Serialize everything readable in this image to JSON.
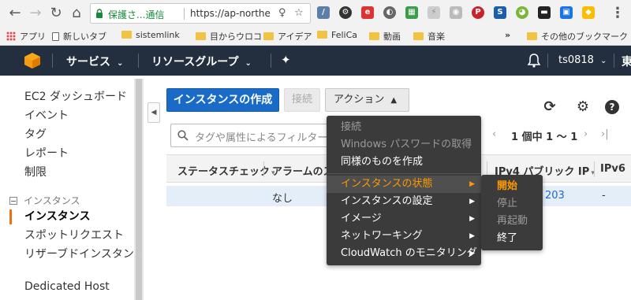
{
  "browser": {
    "secure_label": "保護さ...通信",
    "url": "https://ap-northe",
    "bookmarks": [
      "アプリ",
      "新しいタブ",
      "sistemlink",
      "目からウロコ",
      "アイデア",
      "FeliCa",
      "動画",
      "音楽",
      "その他のブックマーク"
    ],
    "overflow": "»"
  },
  "aws_nav": {
    "services": "サービス",
    "resource_groups": "リソースグループ",
    "user": "ts0818",
    "region_partial": "東"
  },
  "sidebar": {
    "items": [
      "EC2 ダッシュボード",
      "イベント",
      "タグ",
      "レポート",
      "制限"
    ],
    "section": "インスタンス",
    "section_items": [
      "インスタンス",
      "スポットリクエスト",
      "リザーブドインスタンス",
      "Dedicated Host"
    ],
    "active_item": "インスタンス"
  },
  "toolbar": {
    "create_label": "インスタンスの作成",
    "connect_label": "接続",
    "action_label": "アクション"
  },
  "filter": {
    "placeholder": "タグや属性によるフィルター"
  },
  "pagination": {
    "text": "1 個中 1 ～ 1"
  },
  "table": {
    "headers": [
      "ステータスチェック",
      "アラームのス",
      "IPv4 パブリック IP",
      "IPv6"
    ],
    "row": {
      "alarm": "なし",
      "ip_partial": "203",
      "ipv6": "-"
    }
  },
  "action_menu": {
    "items": [
      {
        "label": "接続",
        "enabled": false,
        "has_submenu": false
      },
      {
        "label": "Windows パスワードの取得",
        "enabled": false,
        "has_submenu": false
      },
      {
        "label": "同様のものを作成",
        "enabled": true,
        "has_submenu": false
      },
      {
        "label": "インスタンスの状態",
        "enabled": true,
        "has_submenu": true,
        "highlighted": true
      },
      {
        "label": "インスタンスの設定",
        "enabled": true,
        "has_submenu": true
      },
      {
        "label": "イメージ",
        "enabled": true,
        "has_submenu": true
      },
      {
        "label": "ネットワーキング",
        "enabled": true,
        "has_submenu": true
      },
      {
        "label": "CloudWatch のモニタリング",
        "enabled": true,
        "has_submenu": true
      }
    ]
  },
  "state_submenu": {
    "items": [
      {
        "label": "開始",
        "enabled": true,
        "active": true
      },
      {
        "label": "停止",
        "enabled": false
      },
      {
        "label": "再起動",
        "enabled": false
      },
      {
        "label": "終了",
        "enabled": true
      }
    ]
  },
  "colors": {
    "aws_nav_bg": "#232f3e",
    "primary_button": "#1a6bc8",
    "accent_orange": "#ff9900",
    "menu_bg": "#3b3b3b"
  }
}
